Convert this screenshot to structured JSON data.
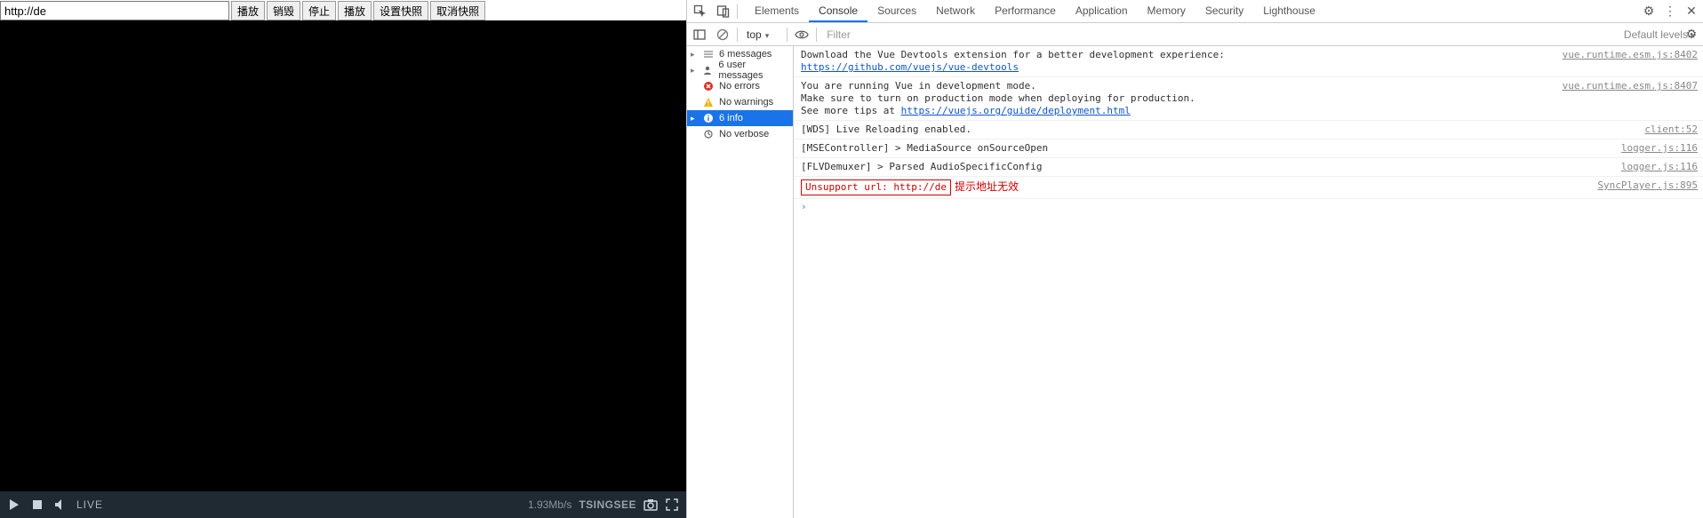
{
  "player": {
    "url_value": "http://de",
    "buttons": [
      "播放",
      "销毁",
      "停止",
      "播放",
      "设置快照",
      "取消快照"
    ],
    "controls": {
      "live_label": "LIVE",
      "bitrate": "1.93Mb/s",
      "brand": "TSINGSEE"
    }
  },
  "devtools": {
    "tabs": [
      "Elements",
      "Console",
      "Sources",
      "Network",
      "Performance",
      "Application",
      "Memory",
      "Security",
      "Lighthouse"
    ],
    "active_tab_index": 1,
    "subbar": {
      "context": "top",
      "filter_placeholder": "Filter",
      "levels": "Default levels"
    },
    "sidebar": {
      "items": [
        {
          "label": "6 messages",
          "icon": "list",
          "expandable": true,
          "selected": false
        },
        {
          "label": "6 user messages",
          "icon": "user",
          "expandable": true,
          "selected": false
        },
        {
          "label": "No errors",
          "icon": "error",
          "expandable": false,
          "selected": false
        },
        {
          "label": "No warnings",
          "icon": "warning",
          "expandable": false,
          "selected": false
        },
        {
          "label": "6 info",
          "icon": "info",
          "expandable": true,
          "selected": true
        },
        {
          "label": "No verbose",
          "icon": "verbose",
          "expandable": false,
          "selected": false
        }
      ]
    },
    "messages": [
      {
        "text": "Download the Vue Devtools extension for a better development experience:",
        "link": "https://github.com/vuejs/vue-devtools",
        "source": "vue.runtime.esm.js:8402"
      },
      {
        "text": "You are running Vue in development mode.\nMake sure to turn on production mode when deploying for production.\nSee more tips at ",
        "link": "https://vuejs.org/guide/deployment.html",
        "source": "vue.runtime.esm.js:8407"
      },
      {
        "text": "[WDS] Live Reloading enabled.",
        "source": "client:52"
      },
      {
        "text": "[MSEController] > MediaSource onSourceOpen",
        "source": "logger.js:116"
      },
      {
        "text": "[FLVDemuxer] > Parsed AudioSpecificConfig",
        "source": "logger.js:116"
      },
      {
        "text": "Unsupport url: http://de",
        "source": "SyncPlayer.js:895",
        "error": true,
        "annotation": "提示地址无效"
      }
    ]
  }
}
